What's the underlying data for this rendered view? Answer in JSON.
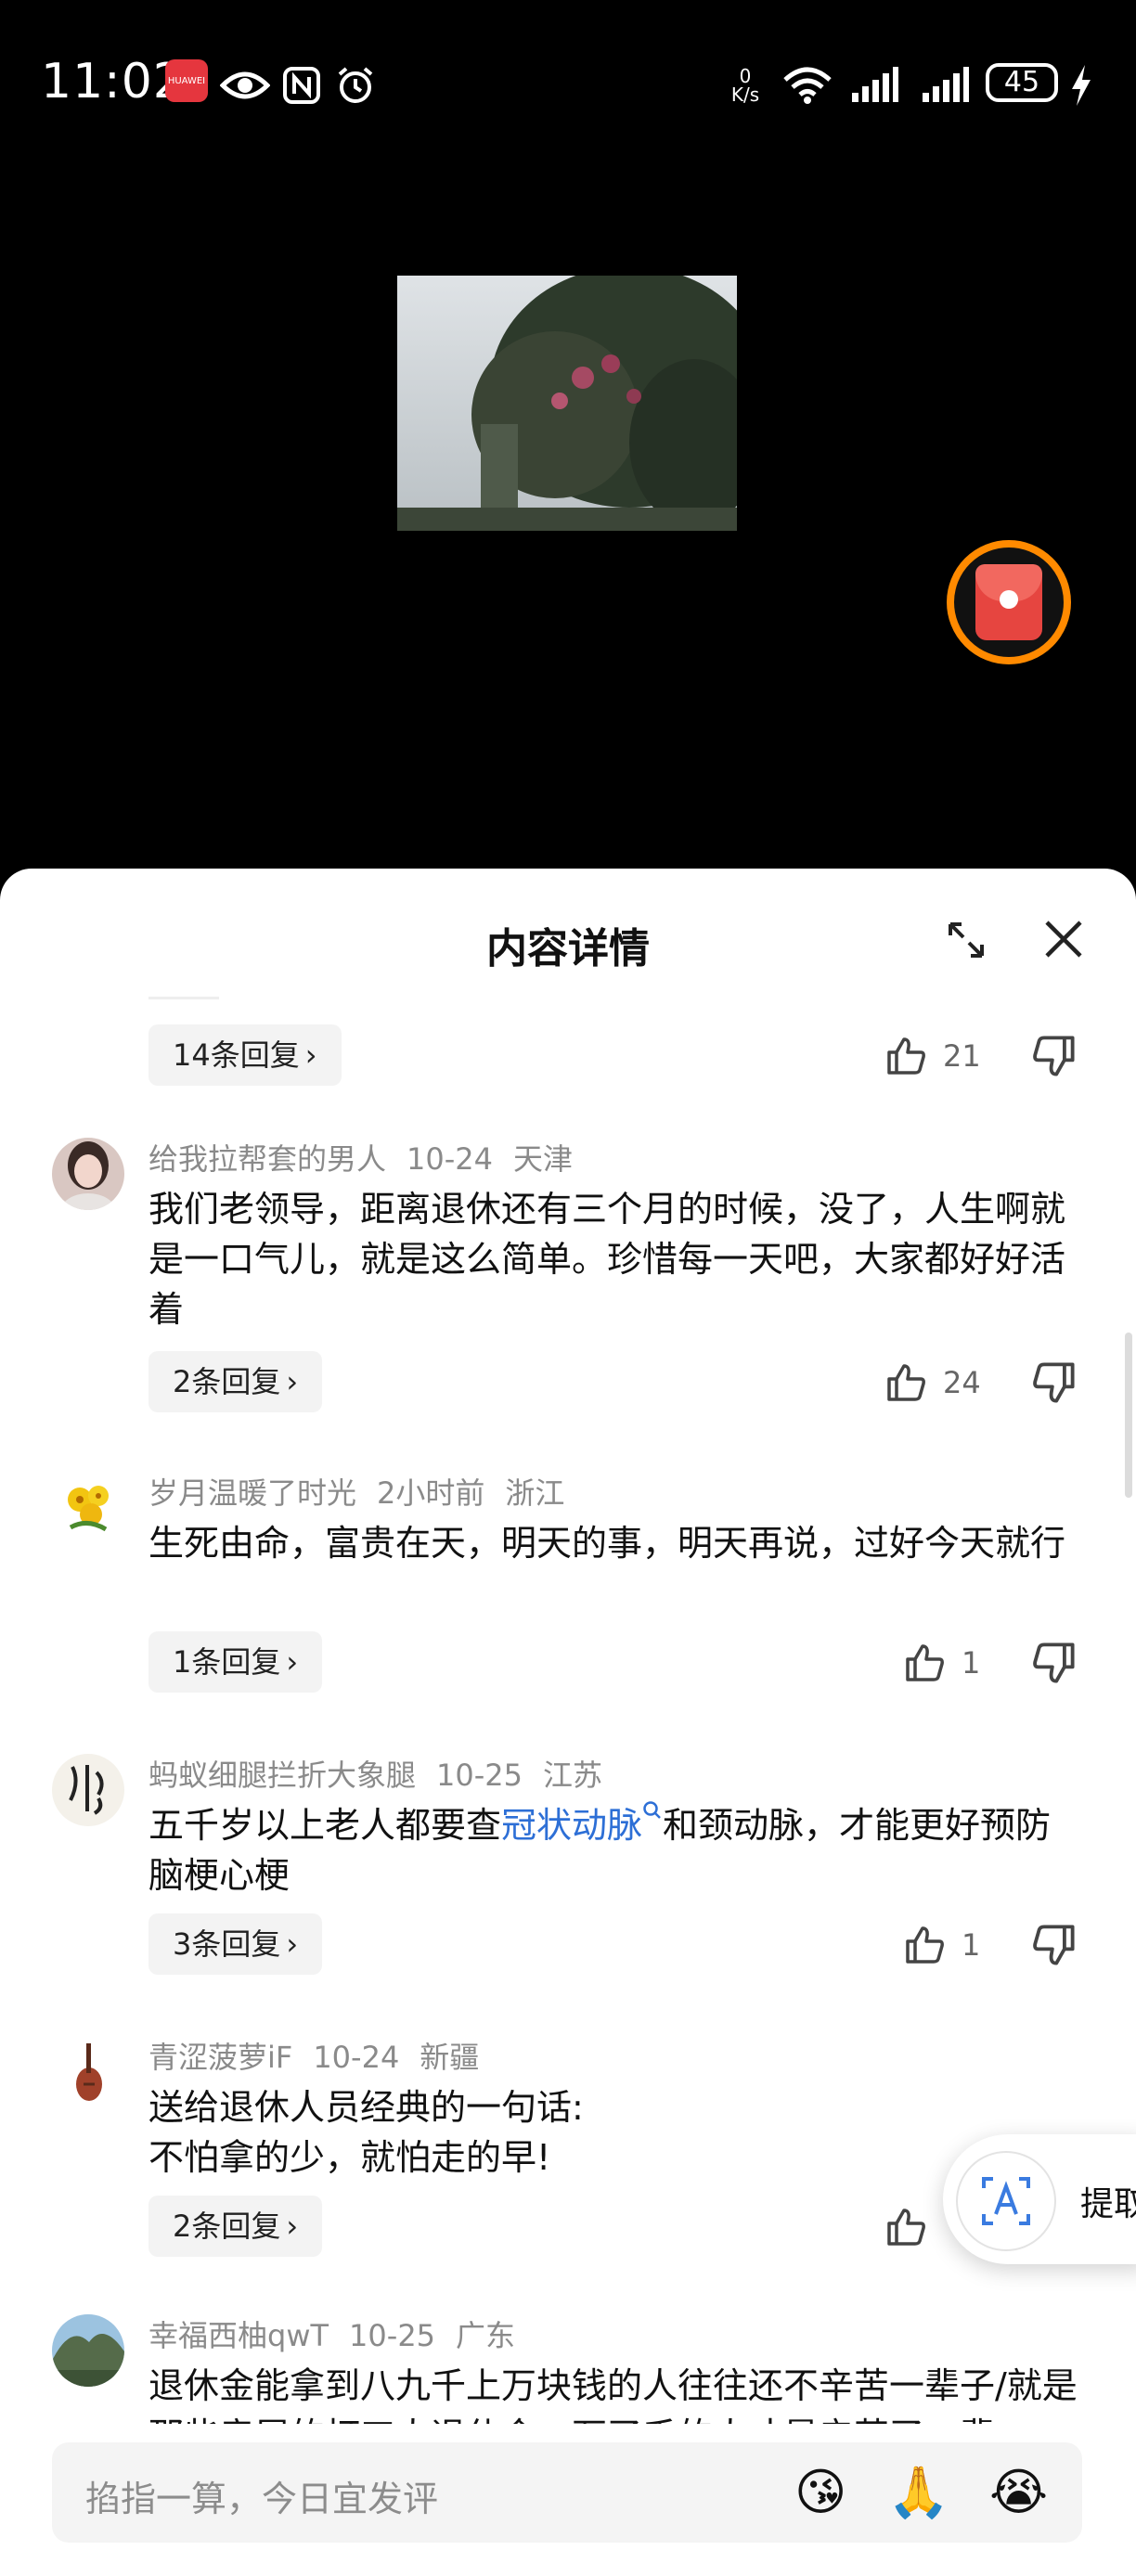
{
  "status_bar": {
    "time": "11:02",
    "app_badge": "HUAWEI",
    "net_speed_value": "0",
    "net_speed_unit": "K/s",
    "battery": "45"
  },
  "panel": {
    "title": "内容详情"
  },
  "first_replies": {
    "label": "14条回复",
    "likes": "21"
  },
  "comments": [
    {
      "user": "给我拉帮套的男人",
      "date": "10-24",
      "region": "天津",
      "text": "我们老领导，距离退休还有三个月的时候，没了，人生啊就是一口气儿，就是这么简单。珍惜每一天吧，大家都好好活着",
      "replies": "2条回复",
      "likes": "24"
    },
    {
      "user": "岁月温暖了时光",
      "date": "2小时前",
      "region": "浙江",
      "text": "生死由命，富贵在天，明天的事，明天再说，过好今天就行",
      "replies": "1条回复",
      "likes": "1"
    },
    {
      "user": "蚂蚁细腿拦折大象腿",
      "date": "10-25",
      "region": "江苏",
      "text_before": "五千岁以上老人都要查",
      "text_link": "冠状动脉",
      "text_after": "和颈动脉，才能更好预防脑梗心梗",
      "replies": "3条回复",
      "likes": "1"
    },
    {
      "user": "青涩菠萝iF",
      "date": "10-24",
      "region": "新疆",
      "text_line1": "送给退休人员经典的一句话:",
      "text_line2": "不怕拿的少，就怕走的早!",
      "replies": "2条回复"
    },
    {
      "user": "幸福西柚qwT",
      "date": "10-25",
      "region": "广东",
      "text": "退休金能拿到八九千上万块钱的人往往还不辛苦一辈子/就是那些房屋的打工人退休金一万了千的人才是辛苦了一辈"
    }
  ],
  "floating_tool": {
    "label": "提取"
  },
  "input": {
    "placeholder": "掐指一算，今日宜发评"
  },
  "emojis": [
    "😘",
    "🙏",
    "😭"
  ]
}
